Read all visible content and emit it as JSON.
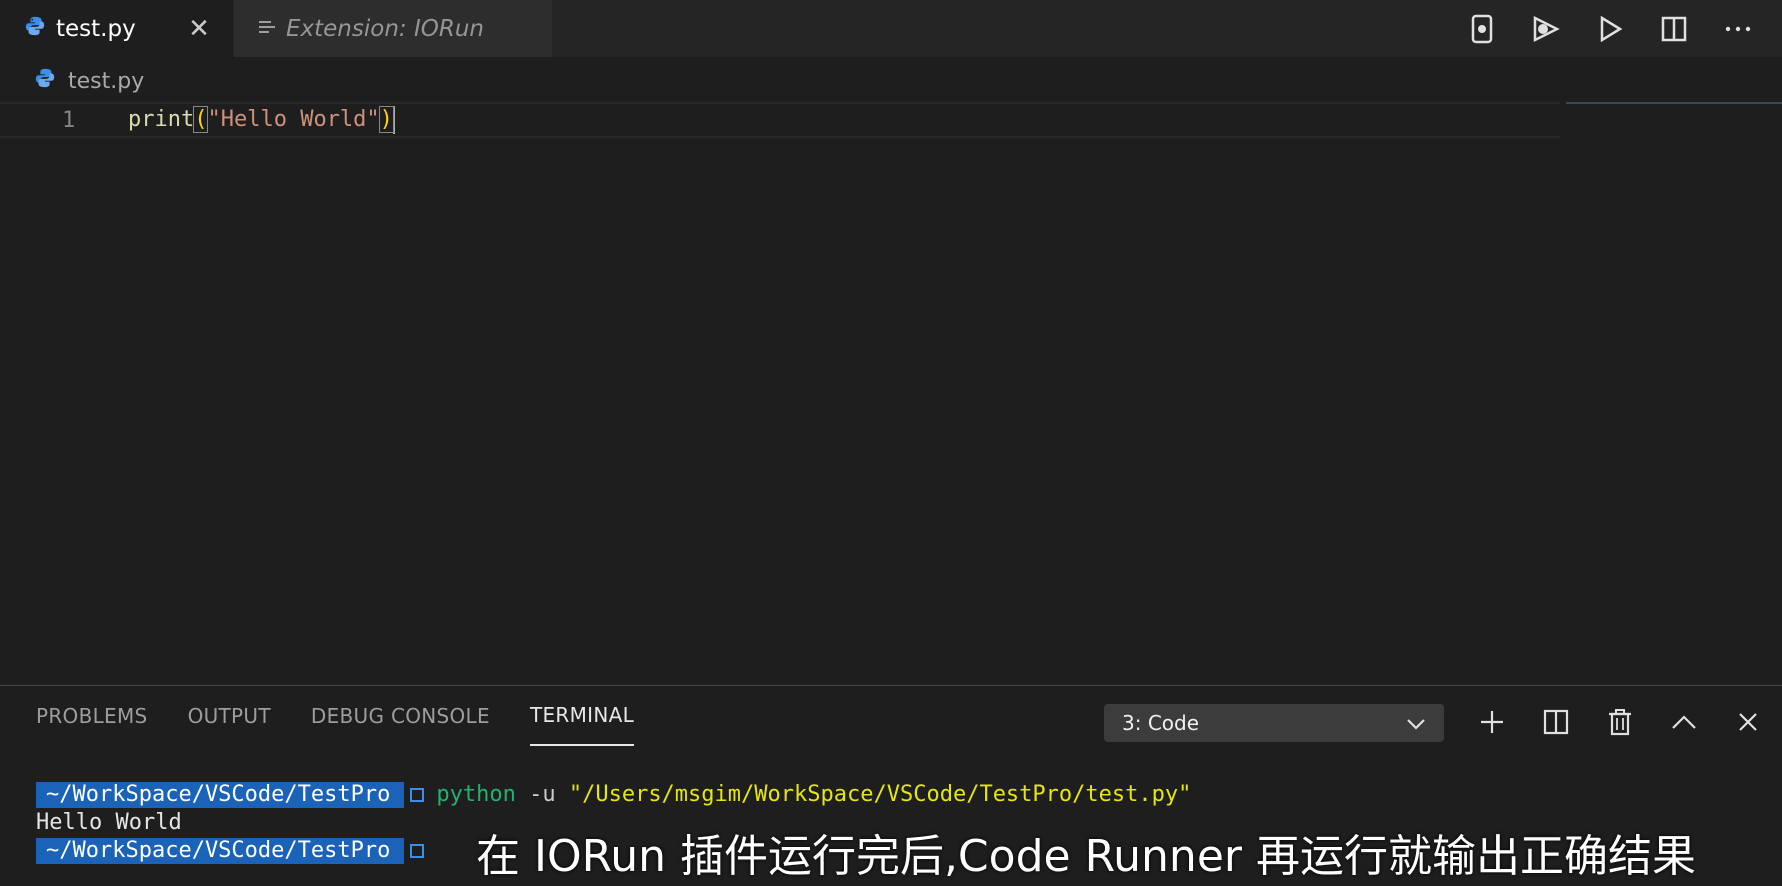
{
  "tabs": [
    {
      "label": "test.py",
      "close": "✕"
    },
    {
      "label": "Extension: IORun"
    }
  ],
  "breadcrumb": {
    "file": "test.py"
  },
  "editor": {
    "line_number": "1",
    "code": {
      "fn": "print",
      "open": "(",
      "str": "\"Hello World\"",
      "close": ")"
    }
  },
  "panel": {
    "tabs": [
      "PROBLEMS",
      "OUTPUT",
      "DEBUG CONSOLE",
      "TERMINAL"
    ],
    "terminal_select": "3: Code",
    "dropdown_icon": "chevron-down-icon"
  },
  "terminal": {
    "prompt": "~/WorkSpace/VSCode/TestPro",
    "cmd": "python",
    "flag": " -u ",
    "path": "\"/Users/msgim/WorkSpace/VSCode/TestPro/test.py\"",
    "output": "Hello World"
  },
  "subtitle": "在 IORun 插件运行完后,Code Runner 再运行就输出正确结果",
  "colors": {
    "accent": "#1a63b8",
    "python": "#3b8eea",
    "string": "#ce9178",
    "function": "#dcdcaa"
  }
}
